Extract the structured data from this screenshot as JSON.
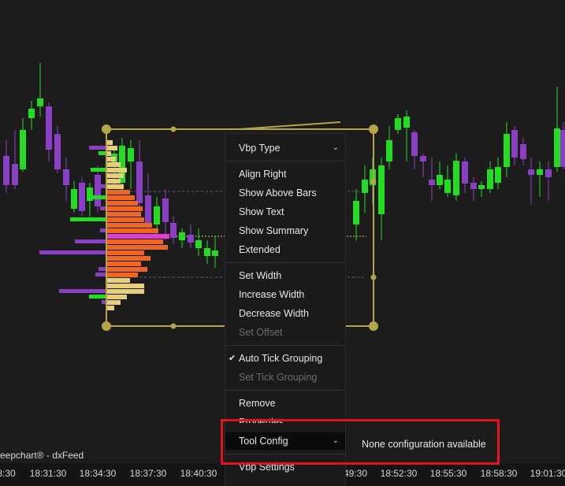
{
  "attribution": "eepchart® - dxFeed",
  "time_axis": [
    "8:30",
    "18:31:30",
    "18:34:30",
    "18:37:30",
    "18:40:30",
    "49:30",
    "18:52:30",
    "18:55:30",
    "18:58:30",
    "19:01:30"
  ],
  "context_menu": {
    "vbp_type": "Vbp Type",
    "align_right": "Align Right",
    "show_above_bars": "Show Above Bars",
    "show_text": "Show Text",
    "show_summary": "Show Summary",
    "extended": "Extended",
    "set_width": "Set Width",
    "increase_width": "Increase Width",
    "decrease_width": "Decrease Width",
    "set_offset": "Set Offset",
    "auto_tick_grouping": "Auto Tick Grouping",
    "set_tick_grouping": "Set Tick Grouping",
    "remove": "Remove",
    "properties": "Properties",
    "tool_config": "Tool Config",
    "vbp_settings": "Vbp Settings"
  },
  "submenu": {
    "message": "None configuration available"
  },
  "colors": {
    "background": "#1c1c1c",
    "bull_candle": "#22dd22",
    "bear_candle": "#8a3fc4",
    "profile_high": "#ee6622",
    "profile_low": "#e8cf7a",
    "poc": "#e23bd8",
    "tool_handles": "#b5a548",
    "highlight_box": "#e0141e"
  }
}
